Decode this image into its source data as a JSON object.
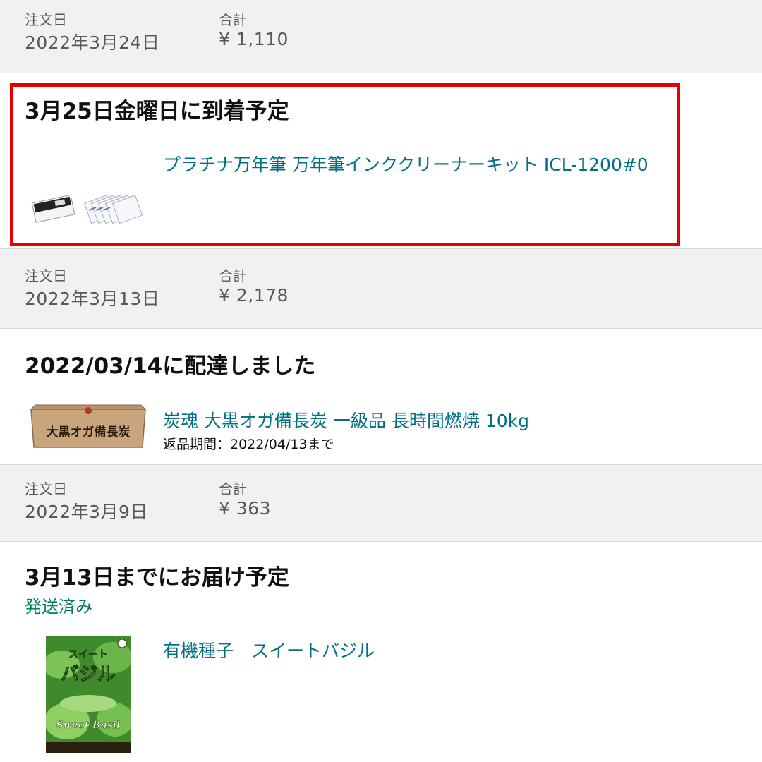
{
  "orders": [
    {
      "order_date_label": "注文日",
      "order_date": "2022年3月24日",
      "total_label": "合計",
      "total": "¥ 1,110",
      "status": "3月25日金曜日に到着予定",
      "product_title": "プラチナ万年筆 万年筆インククリーナーキット ICL-1200#0"
    },
    {
      "order_date_label": "注文日",
      "order_date": "2022年3月13日",
      "total_label": "合計",
      "total": "¥ 2,178",
      "status": "2022/03/14に配達しました",
      "product_title": "炭魂 大黒オガ備長炭 一級品 長時間燃焼 10kg",
      "return_window": "返品期間：2022/04/13まで",
      "box_label": "大黒オガ備長炭"
    },
    {
      "order_date_label": "注文日",
      "order_date": "2022年3月9日",
      "total_label": "合計",
      "total": "¥ 363",
      "status": "3月13日までにお届け予定",
      "shipping_status": "発送済み",
      "product_title": "有機種子　スイートバジル",
      "packet_text": {
        "line1": "スイート",
        "line2": "バジル",
        "line3": "Sweet Basil"
      }
    }
  ],
  "colors": {
    "link": "#007185",
    "shipped_green": "#067d62",
    "highlight_red": "#e30000",
    "header_bg": "#f0f2f2"
  }
}
